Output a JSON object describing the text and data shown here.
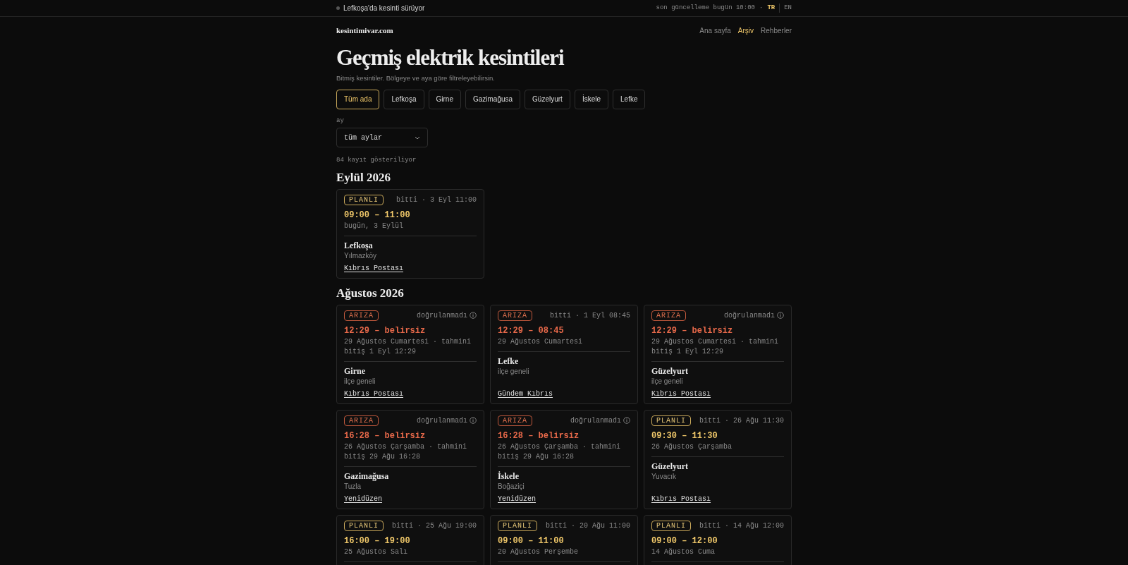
{
  "topbar": {
    "alert": "Lefkoşa'da kesinti sürüyor",
    "updated": "son güncelleme bugün 10:00",
    "separator": "·",
    "languages": [
      {
        "label": "TR",
        "selected": true
      },
      {
        "label": "EN",
        "selected": false
      }
    ]
  },
  "header": {
    "logo": "kesintimivar.com",
    "nav": [
      {
        "label": "Ana sayfa",
        "selected": false
      },
      {
        "label": "Arşiv",
        "selected": true
      },
      {
        "label": "Rehberler",
        "selected": false
      }
    ]
  },
  "title": "Geçmiş elektrik kesintileri",
  "subtitle": "Bitmiş kesintiler. Bölgeye ve aya göre filtreleyebilirsin.",
  "regions": [
    {
      "label": "Tüm ada",
      "selected": true
    },
    {
      "label": "Lefkoşa",
      "selected": false
    },
    {
      "label": "Girne",
      "selected": false
    },
    {
      "label": "Gazimağusa",
      "selected": false
    },
    {
      "label": "Güzelyurt",
      "selected": false
    },
    {
      "label": "İskele",
      "selected": false
    },
    {
      "label": "Lefke",
      "selected": false
    }
  ],
  "month_filter": {
    "label": "ay",
    "value": "tüm aylar"
  },
  "count": "84 kayıt gösteriliyor",
  "groups": [
    {
      "heading": "Eylül 2026",
      "cards": [
        {
          "kind": "planned",
          "badge": "PLANLI",
          "status": "bitti · 3 Eyl 11:00",
          "unverified": false,
          "time": "09:00 – 11:00",
          "date": "bugün, 3 Eylül",
          "region": "Lefkoşa",
          "area": "Yılmazköy",
          "source": "Kıbrıs Postası"
        }
      ]
    },
    {
      "heading": "Ağustos 2026",
      "cards": [
        {
          "kind": "fault",
          "badge": "ARIZA",
          "status": "doğrulanmadı",
          "unverified": true,
          "time": "12:29 – belirsiz",
          "date": "29 Ağustos Cumartesi · tahmini bitiş 1 Eyl 12:29",
          "region": "Girne",
          "area": "ilçe geneli",
          "source": "Kıbrıs Postası"
        },
        {
          "kind": "fault",
          "badge": "ARIZA",
          "status": "bitti · 1 Eyl 08:45",
          "unverified": false,
          "time": "12:29 – 08:45",
          "date": "29 Ağustos Cumartesi",
          "region": "Lefke",
          "area": "ilçe geneli",
          "source": "Gündem Kıbrıs"
        },
        {
          "kind": "fault",
          "badge": "ARIZA",
          "status": "doğrulanmadı",
          "unverified": true,
          "time": "12:29 – belirsiz",
          "date": "29 Ağustos Cumartesi · tahmini bitiş 1 Eyl 12:29",
          "region": "Güzelyurt",
          "area": "ilçe geneli",
          "source": "Kıbrıs Postası"
        },
        {
          "kind": "fault",
          "badge": "ARIZA",
          "status": "doğrulanmadı",
          "unverified": true,
          "time": "16:28 – belirsiz",
          "date": "26 Ağustos Çarşamba · tahmini bitiş 29 Ağu 16:28",
          "region": "Gazimağusa",
          "area": "Tuzla",
          "source": "Yenidüzen"
        },
        {
          "kind": "fault",
          "badge": "ARIZA",
          "status": "doğrulanmadı",
          "unverified": true,
          "time": "16:28 – belirsiz",
          "date": "26 Ağustos Çarşamba · tahmini bitiş 29 Ağu 16:28",
          "region": "İskele",
          "area": "Boğaziçi",
          "source": "Yenidüzen"
        },
        {
          "kind": "planned",
          "badge": "PLANLI",
          "status": "bitti · 26 Ağu 11:30",
          "unverified": false,
          "time": "09:30 – 11:30",
          "date": "26 Ağustos Çarşamba",
          "region": "Güzelyurt",
          "area": "Yuvacık",
          "source": "Kıbrıs Postası"
        },
        {
          "kind": "planned",
          "badge": "PLANLI",
          "status": "bitti · 25 Ağu 19:00",
          "unverified": false,
          "time": "16:00 – 19:00",
          "date": "25 Ağustos Salı"
        },
        {
          "kind": "planned",
          "badge": "PLANLI",
          "status": "bitti · 20 Ağu 11:00",
          "unverified": false,
          "time": "09:00 – 11:00",
          "date": "20 Ağustos Perşembe"
        },
        {
          "kind": "planned",
          "badge": "PLANLI",
          "status": "bitti · 14 Ağu 12:00",
          "unverified": false,
          "time": "09:00 – 12:00",
          "date": "14 Ağustos Cuma"
        }
      ]
    }
  ]
}
